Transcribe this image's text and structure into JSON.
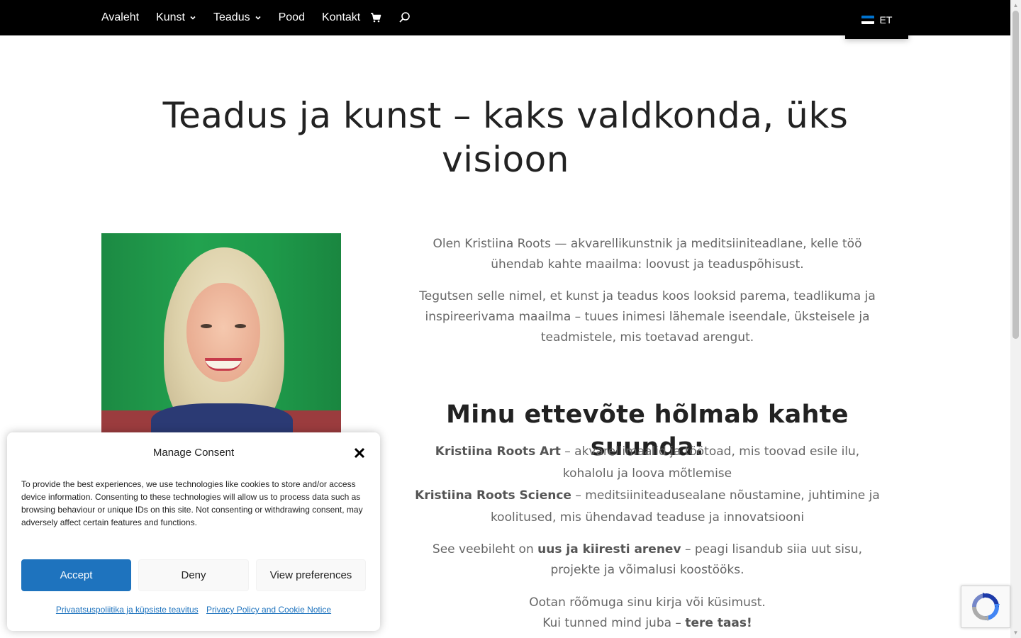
{
  "nav": {
    "items": [
      {
        "label": "Avaleht",
        "has_dropdown": false
      },
      {
        "label": "Kunst",
        "has_dropdown": true
      },
      {
        "label": "Teadus",
        "has_dropdown": true
      },
      {
        "label": "Pood",
        "has_dropdown": false
      },
      {
        "label": "Kontakt",
        "has_dropdown": false
      }
    ],
    "cart_icon": "cart-icon",
    "search_icon": "search-icon",
    "language": {
      "label": "ET",
      "flag_colors": [
        "#0072ce",
        "#000000",
        "#ffffff"
      ]
    }
  },
  "hero": {
    "title": "Teadus ja kunst – kaks valdkonda, üks visioon"
  },
  "intro": {
    "p1": "Olen Kristiina Roots — akvarellikunstnik ja meditsiiniteadlane, kelle töö ühendab kahte maailma: loovust ja teaduspõhisust.",
    "p2": "Tegutsen selle nimel, et kunst ja teadus koos looksid parema, teadlikuma ja inspireerivama maailma – tuues inimesi lähemale iseendale, üksteisele ja teadmistele, mis toetavad arengut."
  },
  "company": {
    "heading": "Minu ettevõte hõlmab kahte suunda:",
    "art_name": "Kristiina Roots Art",
    "art_desc": " – akvarellimaalid ja töötoad, mis toovad esile ilu, kohalolu ja loova mõtlemise",
    "science_name": "Kristiina Roots Science",
    "science_desc": " – meditsiiniteadusealane nõustamine, juhtimine ja koolitused, mis ühendavad teaduse ja innovatsiooni",
    "status_pre": "See veebileht on ",
    "status_bold": "uus ja kiiresti arenev",
    "status_post": " – peagi lisandub siia uut sisu, projekte ja võimalusi koostööks.",
    "closing_line1": "Ootan rõõmuga sinu kirja või küsimust.",
    "closing_line2_pre": "Kui tunned mind juba – ",
    "closing_line2_bold": "tere taas!"
  },
  "consent": {
    "title": "Manage Consent",
    "body": "To provide the best experiences, we use technologies like cookies to store and/or access device information. Consenting to these technologies will allow us to process data such as browsing behaviour or unique IDs on this site. Not consenting or withdrawing consent, may adversely affect certain features and functions.",
    "accept_label": "Accept",
    "deny_label": "Deny",
    "prefs_label": "View preferences",
    "link1": "Privaatsuspoliitika ja küpsiste teavitus",
    "link2": "Privacy Policy and Cookie Notice",
    "accent": "#1e73be"
  },
  "recaptcha": {
    "icon": "recaptcha-icon"
  }
}
